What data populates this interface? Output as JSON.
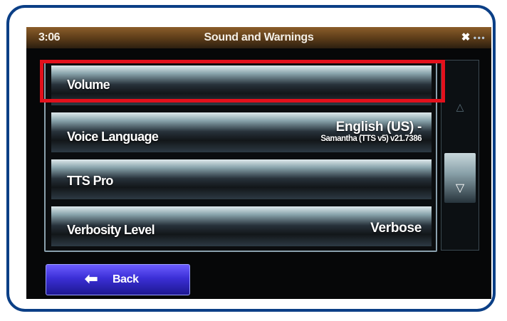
{
  "status_bar": {
    "time": "3:06",
    "title": "Sound and Warnings"
  },
  "settings": [
    {
      "label": "Volume",
      "value": "",
      "value_sub": ""
    },
    {
      "label": "Voice Language",
      "value": "English (US) -",
      "value_sub": "Samantha (TTS v5) v21.7386"
    },
    {
      "label": "TTS Pro",
      "value": "",
      "value_sub": ""
    },
    {
      "label": "Verbosity Level",
      "value": "Verbose",
      "value_sub": ""
    }
  ],
  "back_button": {
    "label": "Back",
    "icon": "arrow-left-icon"
  },
  "highlight_color": "#e3111c",
  "frame_color": "#0b3f86"
}
